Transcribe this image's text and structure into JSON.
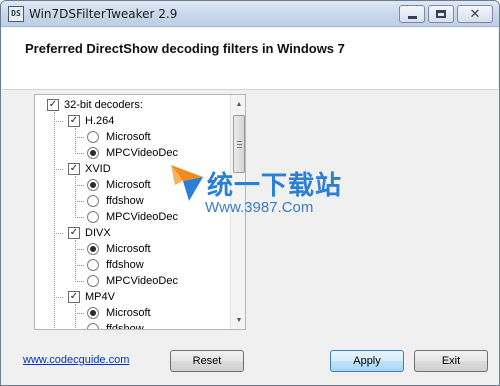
{
  "window": {
    "title": "Win7DSFilterTweaker 2.9",
    "icon_label": "DS"
  },
  "header": {
    "title": "Preferred DirectShow decoding filters in Windows 7"
  },
  "tree": {
    "root": {
      "label": "32-bit decoders:",
      "checked": true
    },
    "groups": [
      {
        "label": "H.264",
        "checked": true,
        "options": [
          {
            "label": "Microsoft",
            "selected": false
          },
          {
            "label": "MPCVideoDec",
            "selected": true
          }
        ]
      },
      {
        "label": "XVID",
        "checked": true,
        "options": [
          {
            "label": "Microsoft",
            "selected": true
          },
          {
            "label": "ffdshow",
            "selected": false
          },
          {
            "label": "MPCVideoDec",
            "selected": false
          }
        ]
      },
      {
        "label": "DIVX",
        "checked": true,
        "options": [
          {
            "label": "Microsoft",
            "selected": true
          },
          {
            "label": "ffdshow",
            "selected": false
          },
          {
            "label": "MPCVideoDec",
            "selected": false
          }
        ]
      },
      {
        "label": "MP4V",
        "checked": true,
        "options": [
          {
            "label": "Microsoft",
            "selected": true
          },
          {
            "label": "ffdshow",
            "selected": false
          }
        ]
      }
    ]
  },
  "watermark": {
    "title": "统一下载站",
    "url": "Www.3987.Com"
  },
  "footer": {
    "link_text": "www.codecguide.com",
    "reset_label": "Reset",
    "apply_label": "Apply",
    "exit_label": "Exit"
  },
  "colors": {
    "link": "#0033cc",
    "watermark_blue": "#2b7fd6",
    "watermark_orange": "#f28a1c"
  }
}
